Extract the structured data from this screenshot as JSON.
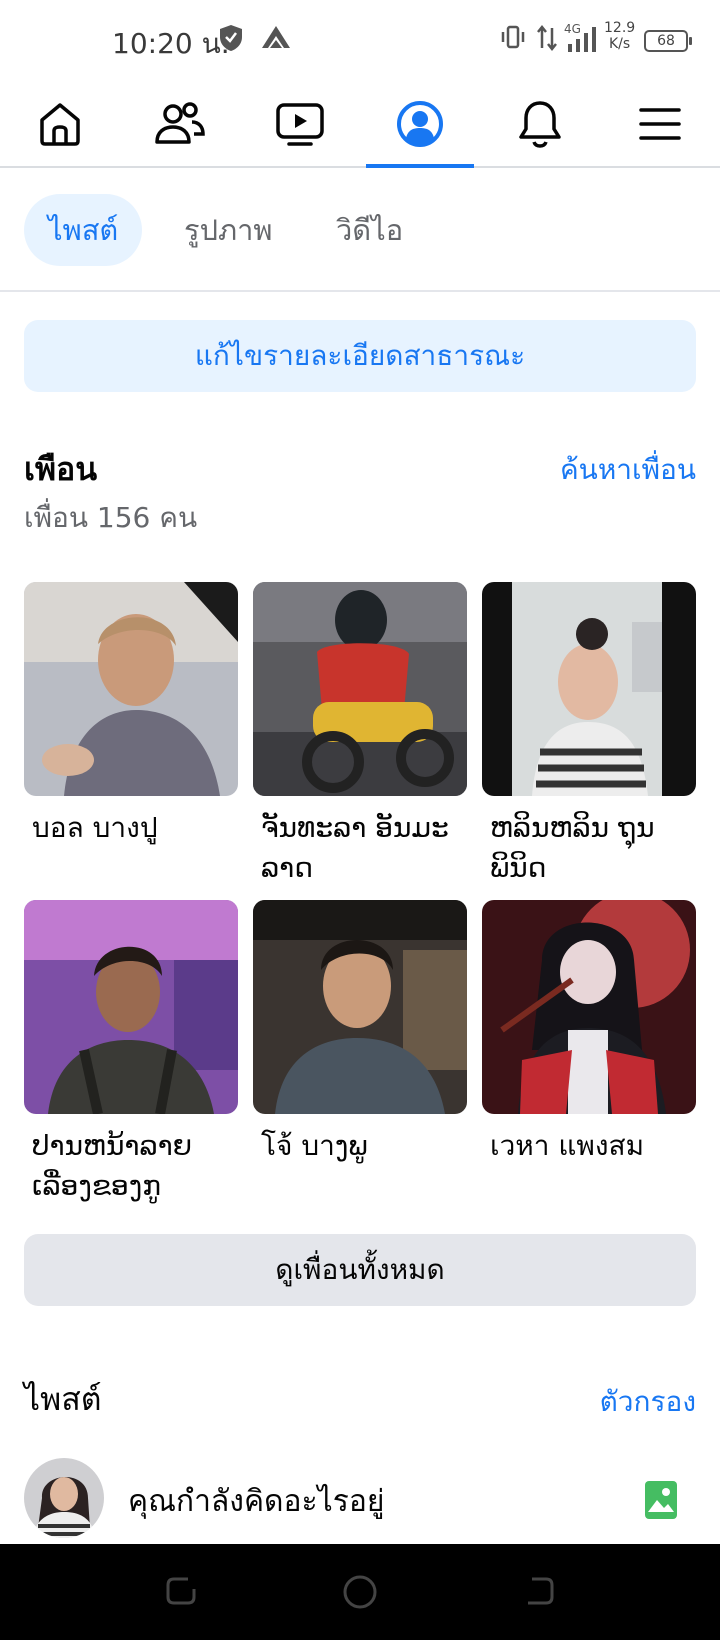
{
  "status_bar": {
    "time": "10:20 น.",
    "network": "4G",
    "speed_value": "12.9",
    "speed_unit": "K/s",
    "battery": "68"
  },
  "top_nav": {
    "items": [
      {
        "icon": "home-icon"
      },
      {
        "icon": "friends-icon"
      },
      {
        "icon": "video-icon"
      },
      {
        "icon": "profile-icon",
        "active": true
      },
      {
        "icon": "bell-icon"
      },
      {
        "icon": "menu-icon"
      }
    ]
  },
  "sub_tabs": {
    "posts": "ไพสต์",
    "photos": "รูปภาพ",
    "videos": "วิดีไอ"
  },
  "edit_public_details": "แก้ไขรายละเอียดสาธารณะ",
  "friends": {
    "title": "เพือน",
    "find_link": "ค้นหาเพื่อน",
    "count": "เพื่อน 156 คน",
    "items": [
      {
        "line1": "บอล บางปู",
        "line2": ""
      },
      {
        "line1": "ຈັນທະລາ ອັນມະ",
        "line2": "ລາດ"
      },
      {
        "line1": "ຫລິນຫລິນ ຖຸນ",
        "line2": "ພິນິດ"
      },
      {
        "line1": "ປານຫນ້າລາຍ",
        "line2": "ເລື່ອງຂອງກູ"
      },
      {
        "line1": "โจ้ บาງພູ",
        "line2": ""
      },
      {
        "line1": "เวหา แพงสม",
        "line2": ""
      }
    ],
    "see_all": "ดูเพื่อนทั้งหมด"
  },
  "posts": {
    "title": "ไพสต์",
    "filter": "ตัวกรอง",
    "composer_prompt": "คุณกำลังคิดอะไรอยู่"
  },
  "colors": {
    "accent": "#1877f2",
    "accent_light": "#e7f3ff",
    "secondary_button": "#e4e6eb",
    "photo_icon": "#45bd62"
  }
}
